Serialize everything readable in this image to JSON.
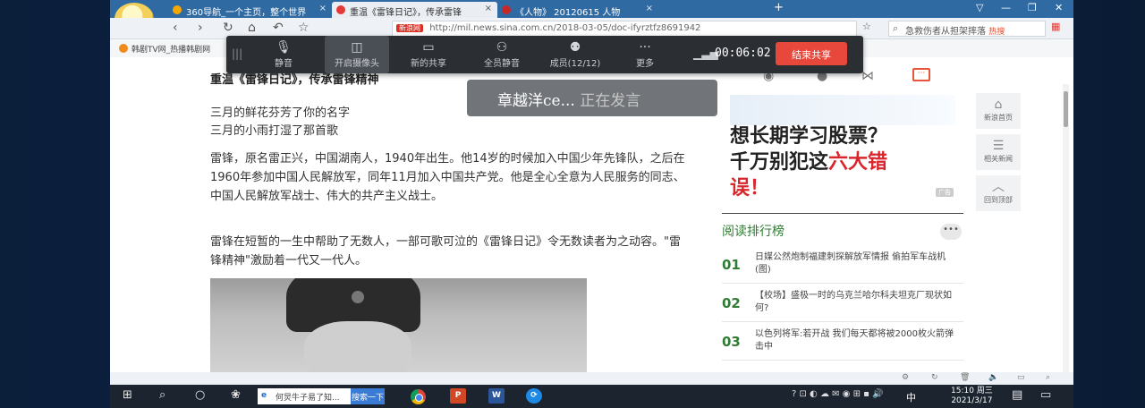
{
  "browser": {
    "tabs": [
      {
        "label": "360导航_一个主页，整个世界",
        "icon_color": "#f6a800"
      },
      {
        "label": "重温《雷锋日记》，传承雷锋",
        "icon_color": "#e53935"
      },
      {
        "label": "《人物》 20120615 人物",
        "icon_color": "#c62828"
      }
    ],
    "new_tab": "+",
    "url_badge": "新浪网",
    "url": "http://mil.news.sina.com.cn/2018-03-05/doc-ifyrztfz8691942",
    "search_placeholder": "急救伤者从担架摔落",
    "search_hot": "热搜",
    "bookmark": "韩剧TV网_热播韩剧网"
  },
  "meeting": {
    "buttons": [
      {
        "label": "静音",
        "icon": "mic-icon"
      },
      {
        "label": "开启摄像头",
        "icon": "camera-icon"
      },
      {
        "label": "新的共享",
        "icon": "share-screen-icon"
      },
      {
        "label": "全员静音",
        "icon": "mute-all-icon"
      },
      {
        "label": "成员(12/12)",
        "icon": "members-icon"
      },
      {
        "label": "更多",
        "icon": "more-icon"
      }
    ],
    "timer": "00:06:02",
    "end_share": "结束共享",
    "speaker_name": "章越洋ce...",
    "speaker_status": "正在发言"
  },
  "article": {
    "title": "重温《雷锋日记》，传承雷锋精神",
    "poem": [
      "三月的鲜花芬芳了你的名字",
      "三月的小雨打湿了那首歌"
    ],
    "para1": "雷锋，原名雷正兴，中国湖南人，1940年出生。他14岁的时候加入中国少年先锋队，之后在1960年参加中国人民解放军，同年11月加入中国共产党。他是全心全意为人民服务的同志、中国人民解放军战士、伟大的共产主义战士。",
    "para2": "雷锋在短暂的一生中帮助了无数人，一部可歌可泣的《雷锋日记》令无数读者为之动容。\"雷锋精神\"激励着一代又一代人。"
  },
  "ad": {
    "line1": "想长期学习股票？",
    "line2a": "千万别犯这",
    "line2b": "六大错",
    "line3": "误！",
    "badge": "广告"
  },
  "ranking": {
    "title": "阅读排行榜",
    "more": "•••",
    "items": [
      {
        "num": "01",
        "text": "日媒公然炮制福建刺探解放军情报 偷拍军车战机(图)"
      },
      {
        "num": "02",
        "text": "【校场】盛极一时的乌克兰哈尔科夫坦克厂现状如何?"
      },
      {
        "num": "03",
        "text": "以色列将军:若开战 我们每天都将被2000枚火箭弹击中"
      }
    ]
  },
  "sidetools": [
    {
      "label": "新浪首页",
      "icon": "home-icon"
    },
    {
      "label": "相关新闻",
      "icon": "news-icon"
    },
    {
      "label": "回到顶部",
      "icon": "back-to-top-icon"
    }
  ],
  "taskbar": {
    "search_text": "何炅牛子易了知...",
    "search_btn": "搜索一下",
    "lang": "中",
    "time": "15:10 周三",
    "date": "2021/3/17"
  }
}
